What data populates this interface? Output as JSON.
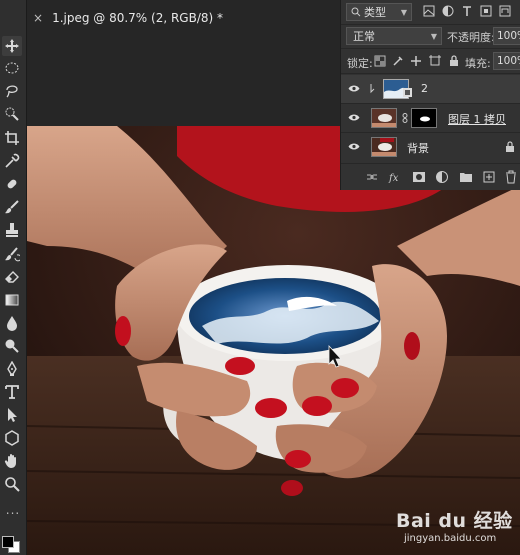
{
  "document_tab": {
    "title": "1.jpeg @ 80.7% (2, RGB/8) *",
    "close_glyph": "×"
  },
  "layers_panel": {
    "filter_kind": "类型",
    "blend_mode": "正常",
    "opacity_label": "不透明度:",
    "opacity_value": "100%",
    "lock_label": "锁定:",
    "fill_label": "填充:",
    "fill_value": "100%",
    "layers": [
      {
        "name": "2",
        "visible": true,
        "selected": true
      },
      {
        "name": "图层 1 拷贝",
        "visible": true,
        "selected": false
      },
      {
        "name": "背景",
        "visible": true,
        "selected": false,
        "locked": true
      }
    ]
  },
  "toolbar": {
    "tools": [
      "move-tool",
      "marquee-tool",
      "lasso-tool",
      "quick-select-tool",
      "crop-tool",
      "eyedropper-tool",
      "healing-brush-tool",
      "brush-tool",
      "stamp-tool",
      "history-brush-tool",
      "eraser-tool",
      "gradient-tool",
      "blur-tool",
      "dodge-tool",
      "pen-tool",
      "type-tool",
      "path-select-tool",
      "shape-tool",
      "hand-tool",
      "zoom-tool"
    ],
    "more_glyph": "..."
  },
  "watermark": {
    "logo_text": "Bai du 经验",
    "url": "jingyan.baidu.com"
  },
  "colors": {
    "panel_bg": "#323232",
    "toolbar_bg": "#2f2f2f",
    "canvas_bg": "#262626",
    "selected_layer": "#3c3c3c"
  }
}
